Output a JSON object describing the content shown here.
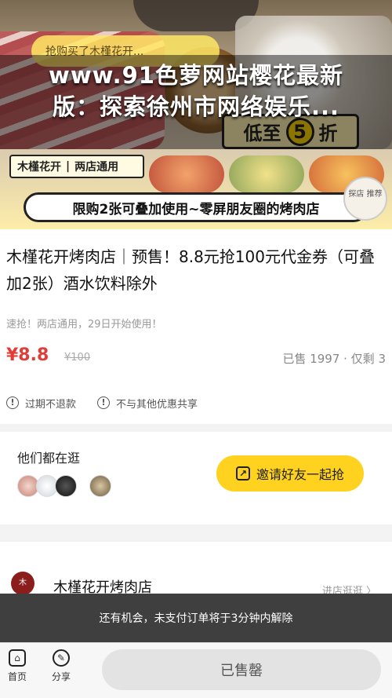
{
  "overlay": {
    "title_line1": "www.91色萝网站樱花最新",
    "title_line2": "版：探索徐州市网络娱乐..."
  },
  "hero": {
    "ticker": "抢购买了木槿花开...",
    "discount_prefix": "低至",
    "discount_number": "5",
    "discount_suffix": "折",
    "brand_name": "木槿花开",
    "brand_scope": "两店通用",
    "slogan": "限购2张可叠加使用~零屏朋友圈的烤肉店",
    "stamp_text": "探店 推荐"
  },
  "product": {
    "title": "木槿花开烤肉店｜预售！8.8元抢100元代金券（可叠加2张）酒水饮料除外",
    "subtitle": "速抢！两店通用，29日开始使用！",
    "price": "¥8.8",
    "original_price": "¥100",
    "sold_info": "已售 1997 · 仅剩 3",
    "policy_1": "过期不退款",
    "policy_2": "不与其他优惠共享"
  },
  "social": {
    "label": "他们都在逛",
    "invite_button": "邀请好友一起抢"
  },
  "shop": {
    "name": "木槿花开烤肉店",
    "enter_link": "进店逛逛 〉"
  },
  "toast": {
    "text": "还有机会，未支付订单将于3分钟内解除"
  },
  "bottom": {
    "home_label": "首页",
    "share_label": "分享",
    "soldout_label": "已售罄"
  }
}
